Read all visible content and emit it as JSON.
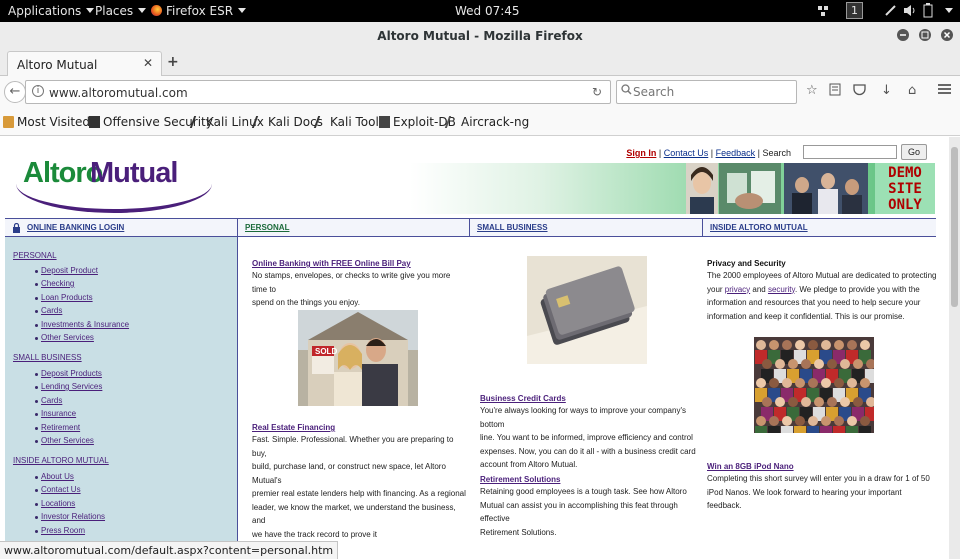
{
  "gnome": {
    "applications": "Applications",
    "places": "Places",
    "app": "Firefox ESR",
    "clock": "Wed 07:45",
    "workspace": "1"
  },
  "window": {
    "title": "Altoro Mutual - Mozilla Firefox"
  },
  "tab": {
    "title": "Altoro Mutual"
  },
  "nav": {
    "url": "www.altoromutual.com",
    "search_placeholder": "Search"
  },
  "bookmarks": [
    "Most Visited",
    "Offensive Security",
    "Kali Linux",
    "Kali Docs",
    "Kali Tools",
    "Exploit-DB",
    "Aircrack-ng"
  ],
  "site": {
    "logo_part1": "Altoro",
    "logo_part2": "Mutual",
    "toplinks": {
      "sign_in": "Sign In",
      "contact": "Contact Us",
      "feedback": "Feedback",
      "search_label": "Search",
      "go": "Go"
    },
    "demo": [
      "DEMO",
      "SITE",
      "ONLY"
    ],
    "nav": [
      "ONLINE BANKING LOGIN",
      "PERSONAL",
      "SMALL BUSINESS",
      "INSIDE ALTORO MUTUAL"
    ],
    "left_menu": {
      "personal_head": "PERSONAL",
      "personal": [
        "Deposit Product",
        "Checking",
        "Loan Products",
        "Cards",
        "Investments & Insurance",
        "Other Services"
      ],
      "business_head": "SMALL BUSINESS",
      "business": [
        "Deposit Products",
        "Lending Services",
        "Cards",
        "Insurance",
        "Retirement",
        "Other Services"
      ],
      "inside_head": "INSIDE ALTORO MUTUAL",
      "inside": [
        "About Us",
        "Contact Us",
        "Locations",
        "Investor Relations",
        "Press Room"
      ]
    },
    "col1": {
      "h1": "Online Banking with FREE Online Bill Pay",
      "p1": [
        "No stamps, envelopes, or checks to write give you more time to",
        "spend on the things you enjoy."
      ],
      "h2": "Real Estate Financing",
      "p2": [
        "Fast. Simple. Professional. Whether you are preparing to buy,",
        "build, purchase land, or construct new space, let Altoro Mutual's",
        "premier real estate lenders help with financing. As a regional",
        "leader, we know the market, we understand the business, and",
        "we have the track record to prove it"
      ],
      "sign_text": "SOLD"
    },
    "col2": {
      "h1": "Business Credit Cards",
      "p1": [
        "You're always looking for ways to improve your company's bottom",
        "line. You want to be informed, improve efficiency and control",
        "expenses. Now, you can do it all - with a business credit card",
        "account from Altoro Mutual."
      ],
      "h2": "Retirement Solutions",
      "p2": [
        "Retaining good employees is a tough task. See how Altoro",
        "Mutual can assist you in accomplishing this feat through effective",
        "Retirement Solutions."
      ]
    },
    "col3": {
      "h1": "Privacy and Security",
      "p1_line1": "The 2000 employees of Altoro Mutual are dedicated to protecting",
      "p1_your": "your",
      "p1_privacy": "privacy",
      "p1_and": "and",
      "p1_security": "security",
      "p1_rest": ". We pledge to provide you with the",
      "p1_line3": "information and resources that you need to help secure your",
      "p1_line4": "information and keep it confidential. This is our promise.",
      "h2": "Win an 8GB iPod Nano",
      "p2": [
        "Completing this short survey will enter you in a draw for 1 of 50",
        "iPod Nanos. We look forward to hearing your important feedback."
      ]
    }
  },
  "status_url": "www.altoromutual.com/default.aspx?content=personal.htm",
  "colors": {
    "purple": "#4a1f7a",
    "green": "#1b8a3a",
    "nav_blue": "#4a4f9a",
    "left_bg": "#c9dfe5",
    "demo_red": "#b00000"
  }
}
